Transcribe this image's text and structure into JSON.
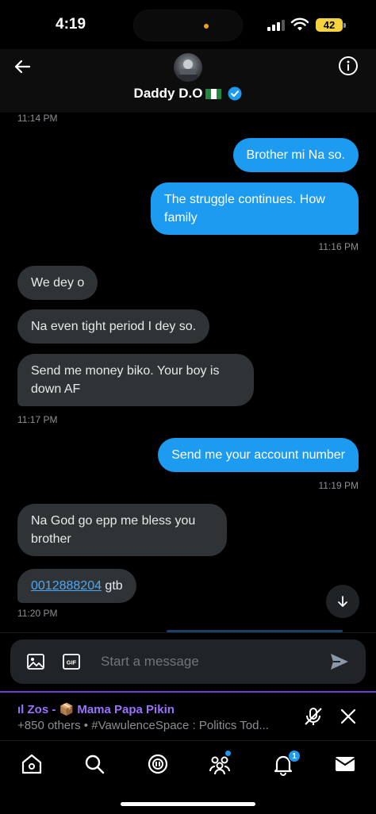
{
  "status_bar": {
    "time": "4:19",
    "battery": "42"
  },
  "header": {
    "name": "Daddy D.O"
  },
  "messages": [
    {
      "type": "timestamp",
      "text": "11:14 PM"
    },
    {
      "type": "outgoing",
      "text": "Brother mi Na so."
    },
    {
      "type": "outgoing",
      "text": "The struggle continues. How family"
    },
    {
      "type": "timestamp",
      "text": "11:16 PM"
    },
    {
      "type": "incoming",
      "text": "We dey o"
    },
    {
      "type": "incoming",
      "text": "Na even tight period I dey so."
    },
    {
      "type": "incoming",
      "text": "Send me money biko. Your boy is down AF"
    },
    {
      "type": "timestamp",
      "text": "11:17 PM"
    },
    {
      "type": "outgoing",
      "text": "Send me your account number"
    },
    {
      "type": "timestamp",
      "text": "11:19 PM"
    },
    {
      "type": "incoming",
      "text": "Na God go epp me bless you brother"
    },
    {
      "type": "incoming",
      "link": "0012888204",
      "text": " gtb"
    },
    {
      "type": "timestamp",
      "text": "11:20 PM"
    }
  ],
  "composer": {
    "placeholder": "Start a message"
  },
  "space": {
    "line1": "ıl Zos - 📦 Mama Papa Pikin",
    "line2": "+850 others • #VawulenceSpace : Politics Tod..."
  },
  "tab_bar": {
    "notifications_count": "1"
  },
  "colors": {
    "accent": "#1d9bf0",
    "incoming_bubble": "#2f3336",
    "space_purple": "#9a72ff"
  }
}
